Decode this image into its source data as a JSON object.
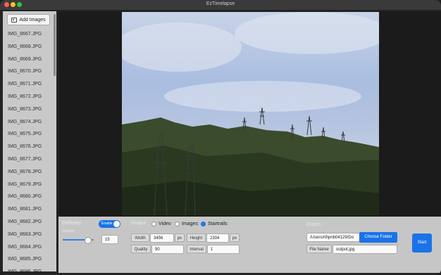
{
  "window": {
    "title": "EzTimelapse"
  },
  "sidebar": {
    "add_images_label": "Add Images",
    "files": [
      "IMG_8667.JPG",
      "IMG_8668.JPG",
      "IMG_8669.JPG",
      "IMG_8670.JPG",
      "IMG_8671.JPG",
      "IMG_8672.JPG",
      "IMG_8673.JPG",
      "IMG_8674.JPG",
      "IMG_8675.JPG",
      "IMG_8676.JPG",
      "IMG_8677.JPG",
      "IMG_8678.JPG",
      "IMG_8679.JPG",
      "IMG_8680.JPG",
      "IMG_8681.JPG",
      "IMG_8682.JPG",
      "IMG_8683.JPG",
      "IMG_8684.JPG",
      "IMG_8685.JPG",
      "IMG_8686.JPG"
    ]
  },
  "deflicker": {
    "title": "Deflicker",
    "toggle_label": "Enable",
    "enabled": true,
    "smooth_label": "Smooth",
    "smooth_value": "15",
    "slider_fraction": 0.8
  },
  "output": {
    "title": "Output",
    "modes": [
      {
        "label": "Video",
        "selected": false
      },
      {
        "label": "Images",
        "selected": false
      },
      {
        "label": "Startrails",
        "selected": true
      }
    ],
    "width_label": "Width",
    "width_value": "3456",
    "height_label": "Height",
    "height_value": "2304",
    "unit_px": "px",
    "quality_label": "Quality",
    "quality_value": "90",
    "interval_label": "Interval",
    "interval_value": "1"
  },
  "export": {
    "title": "Export",
    "path_value": "/Users/rthpnb04129/Do",
    "choose_folder_label": "Choose Folder",
    "file_name_label": "File Name",
    "file_name_value": "output.jpg"
  },
  "actions": {
    "start_label": "Start"
  },
  "colors": {
    "accent": "#1a73e8",
    "sidebar_bg": "#c9c9c9",
    "panel_bg": "#c6c6c6"
  }
}
